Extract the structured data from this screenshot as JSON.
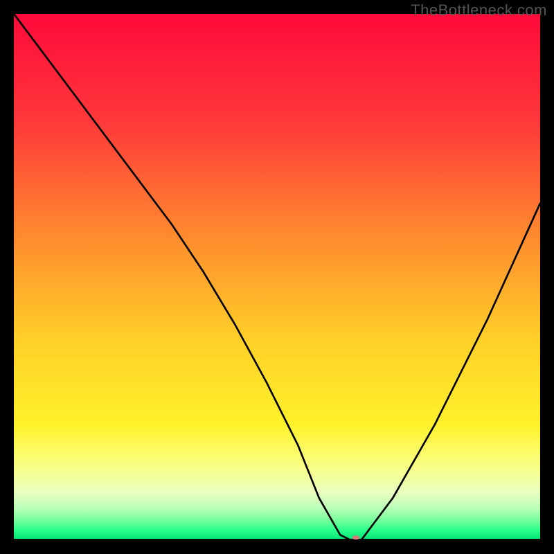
{
  "watermark": "TheBottleneck.com",
  "chart_data": {
    "type": "line",
    "title": "",
    "xlabel": "",
    "ylabel": "",
    "xlim": [
      0,
      100
    ],
    "ylim": [
      0,
      100
    ],
    "gradient_stops": [
      {
        "offset": 0,
        "color": "#ff0a3a"
      },
      {
        "offset": 20,
        "color": "#ff373a"
      },
      {
        "offset": 42,
        "color": "#ff8a2e"
      },
      {
        "offset": 62,
        "color": "#ffd028"
      },
      {
        "offset": 78,
        "color": "#fff22a"
      },
      {
        "offset": 86,
        "color": "#f9ff86"
      },
      {
        "offset": 91,
        "color": "#e9ffbf"
      },
      {
        "offset": 94,
        "color": "#b8ffb8"
      },
      {
        "offset": 96,
        "color": "#7eff9e"
      },
      {
        "offset": 98,
        "color": "#2dff8a"
      },
      {
        "offset": 100,
        "color": "#00e676"
      }
    ],
    "series": [
      {
        "name": "bottleneck_curve",
        "x": [
          0,
          6,
          12,
          18,
          24,
          30,
          36,
          42,
          48,
          54,
          58,
          62,
          64,
          66,
          72,
          80,
          90,
          100
        ],
        "y": [
          100,
          92,
          84,
          76,
          68,
          60,
          51,
          41,
          30,
          18,
          8,
          1,
          0,
          0,
          8,
          22,
          42,
          64
        ]
      }
    ],
    "marker": {
      "x": 65,
      "y": 0.5,
      "color": "#d97a7a",
      "rx": 7,
      "ry": 4
    },
    "annotations": []
  }
}
